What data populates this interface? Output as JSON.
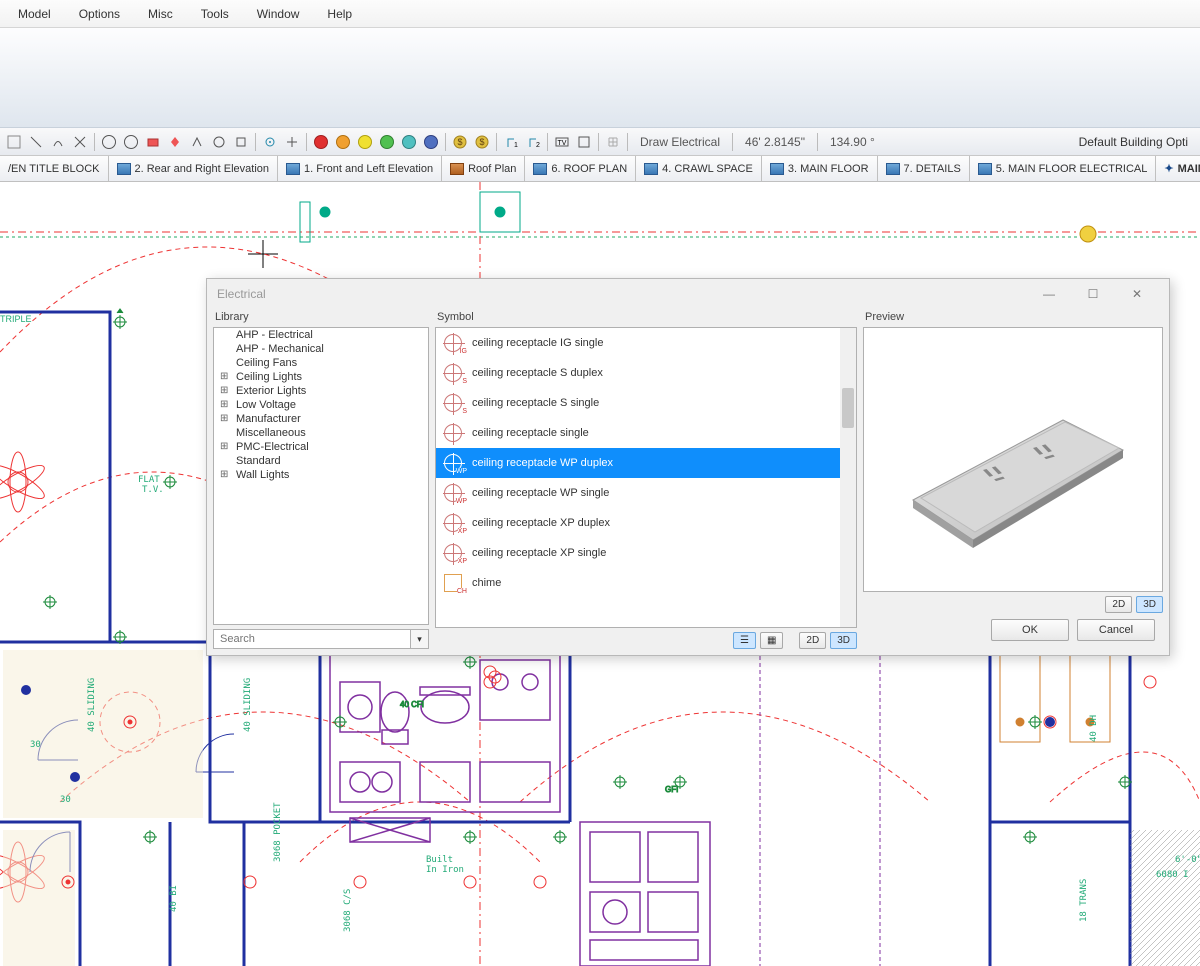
{
  "menu": [
    "Model",
    "Options",
    "Misc",
    "Tools",
    "Window",
    "Help"
  ],
  "toolbar": {
    "mode": "Draw Electrical",
    "measure1": "46' 2.8145\"",
    "measure2": "134.90 °",
    "right": "Default Building Opti"
  },
  "tabs": [
    "/EN TITLE BLOCK",
    "2. Rear and Right Elevation",
    "1. Front and Left Elevation",
    "Roof Plan",
    "6. ROOF PLAN",
    "4. CRAWL SPACE",
    "3. MAIN FLOOR",
    "7. DETAILS",
    "5. MAIN FLOOR ELECTRICAL",
    "MAIN FLOOR"
  ],
  "dialog": {
    "title": "Electrical",
    "library_label": "Library",
    "symbol_label": "Symbol",
    "preview_label": "Preview",
    "search_placeholder": "Search",
    "tree": [
      {
        "label": "AHP - Electrical",
        "exp": false
      },
      {
        "label": "AHP - Mechanical",
        "exp": false
      },
      {
        "label": "Ceiling Fans",
        "exp": false
      },
      {
        "label": "Ceiling Lights",
        "exp": true
      },
      {
        "label": "Exterior Lights",
        "exp": true
      },
      {
        "label": "Low Voltage",
        "exp": true
      },
      {
        "label": "Manufacturer",
        "exp": true
      },
      {
        "label": "Miscellaneous",
        "exp": false
      },
      {
        "label": "PMC-Electrical",
        "exp": true
      },
      {
        "label": "Standard",
        "exp": false
      },
      {
        "label": "Wall Lights",
        "exp": true
      }
    ],
    "symbols": [
      {
        "label": "ceiling receptacle IG single",
        "sub": "IG"
      },
      {
        "label": "ceiling receptacle S duplex",
        "sub": "S"
      },
      {
        "label": "ceiling receptacle S single",
        "sub": "S"
      },
      {
        "label": "ceiling receptacle single",
        "sub": ""
      },
      {
        "label": "ceiling receptacle WP duplex",
        "sub": "WP",
        "selected": true
      },
      {
        "label": "ceiling receptacle WP single",
        "sub": "WP"
      },
      {
        "label": "ceiling receptacle XP duplex",
        "sub": "XP"
      },
      {
        "label": "ceiling receptacle XP single",
        "sub": "XP"
      },
      {
        "label": "chime",
        "sub": "CH",
        "chime": true
      }
    ],
    "btn_2d": "2D",
    "btn_3d": "3D",
    "ok": "OK",
    "cancel": "Cancel"
  }
}
